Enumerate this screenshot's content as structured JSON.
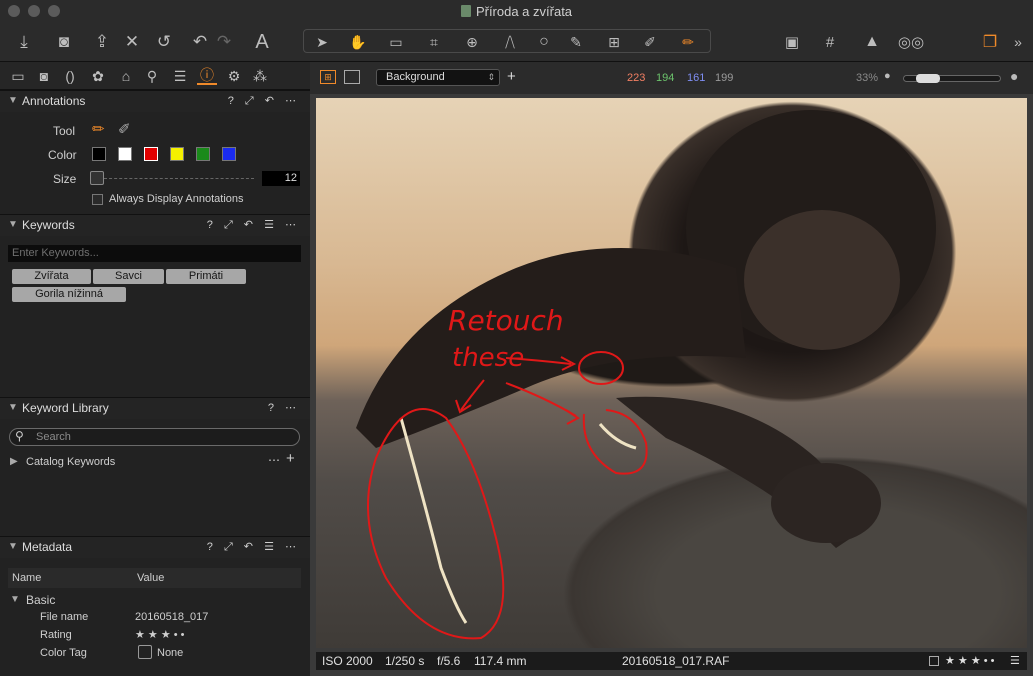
{
  "window": {
    "title": "Příroda a zvířata"
  },
  "toolbar": {
    "text_tool": "A"
  },
  "viewer_bar": {
    "layer_select": "Background",
    "rgb": {
      "r": "223",
      "g": "194",
      "b": "161",
      "a": "199"
    },
    "zoom": "33%"
  },
  "annotations": {
    "title": "Annotations",
    "tool_label": "Tool",
    "color_label": "Color",
    "size_label": "Size",
    "size_value": "12",
    "always_display": "Always Display Annotations",
    "colors": [
      "#000000",
      "#ffffff",
      "#e00000",
      "#f5f000",
      "#1a8a1a",
      "#1a2bf0"
    ]
  },
  "keywords": {
    "title": "Keywords",
    "placeholder": "Enter Keywords...",
    "tags": [
      "Zvířata",
      "Savci",
      "Primáti",
      "Gorila nížinná"
    ]
  },
  "keyword_library": {
    "title": "Keyword Library",
    "search_placeholder": "Search",
    "catalog": "Catalog Keywords"
  },
  "metadata": {
    "title": "Metadata",
    "col_name": "Name",
    "col_value": "Value",
    "group": "Basic",
    "rows": [
      {
        "name": "File name",
        "value": "20160518_017"
      },
      {
        "name": "Rating",
        "value": "★ ★ ★ • •"
      },
      {
        "name": "Color Tag",
        "value": "None"
      }
    ]
  },
  "annotation_text": {
    "line1": "Retouch",
    "line2": "these"
  },
  "status": {
    "iso": "ISO 2000",
    "shutter": "1/250 s",
    "aperture": "f/5.6",
    "focal": "117.4 mm",
    "filename": "20160518_017.RAF",
    "rating": "★ ★ ★ • •"
  }
}
